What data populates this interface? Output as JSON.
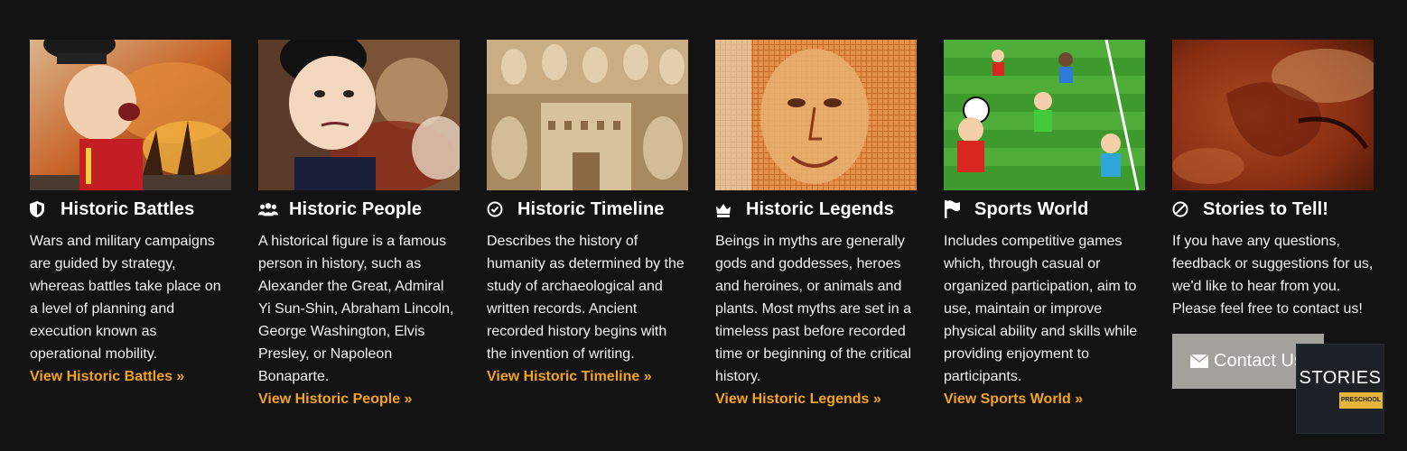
{
  "cards": [
    {
      "icon": "shield-icon",
      "title": "Historic Battles",
      "image": "cartoon-soldier-battle",
      "description": "Wars and military campaigns are guided by strategy, whereas battles take place on a level of planning and execution known as operational mobility.",
      "link": "View Historic Battles »"
    },
    {
      "icon": "group-icon",
      "title": "Historic People",
      "image": "cartoon-napoleon-painting",
      "description": "A historical figure is a famous person in history, such as Alexander the Great, Admiral Yi Sun-Shin, Abraham Lincoln, George Washington, Elvis Presley, or Napoleon Bonaparte.",
      "link": "View Historic People »"
    },
    {
      "icon": "clock-check-icon",
      "title": "Historic Timeline",
      "image": "ivory-carving",
      "description": "Describes the history of humanity as determined by the study of archaeological and written records. Ancient recorded history begins with the invention of writing.",
      "link": "View Historic Timeline »"
    },
    {
      "icon": "crown-icon",
      "title": "Historic Legends",
      "image": "mosaic-face",
      "description": "Beings in myths are generally gods and goddesses, heroes and heroines, or animals and plants. Most myths are set in a timeless past before recorded time or beginning of the critical history.",
      "link": "View Historic Legends »"
    },
    {
      "icon": "flag-icon",
      "title": "Sports World",
      "image": "cartoon-soccer",
      "description": "Includes competitive games which, through casual or organized participation, aim to use, maintain or improve physical ability and skills while providing enjoyment to participants.",
      "link": "View Sports World »"
    },
    {
      "icon": "ban-icon",
      "title": "Stories to Tell!",
      "image": "cave-painting",
      "description": "If you have any questions, feedback or suggestions for us, we'd like to hear from you. Please feel free to contact us!",
      "button": "Contact Us"
    }
  ],
  "badge": {
    "title": "STORIES",
    "subtitle": "PRESCHOOL"
  },
  "colors": {
    "background": "#131313",
    "link": "#f2a51a",
    "button": "#a3a19c",
    "badge_accent": "#e5b53a"
  }
}
